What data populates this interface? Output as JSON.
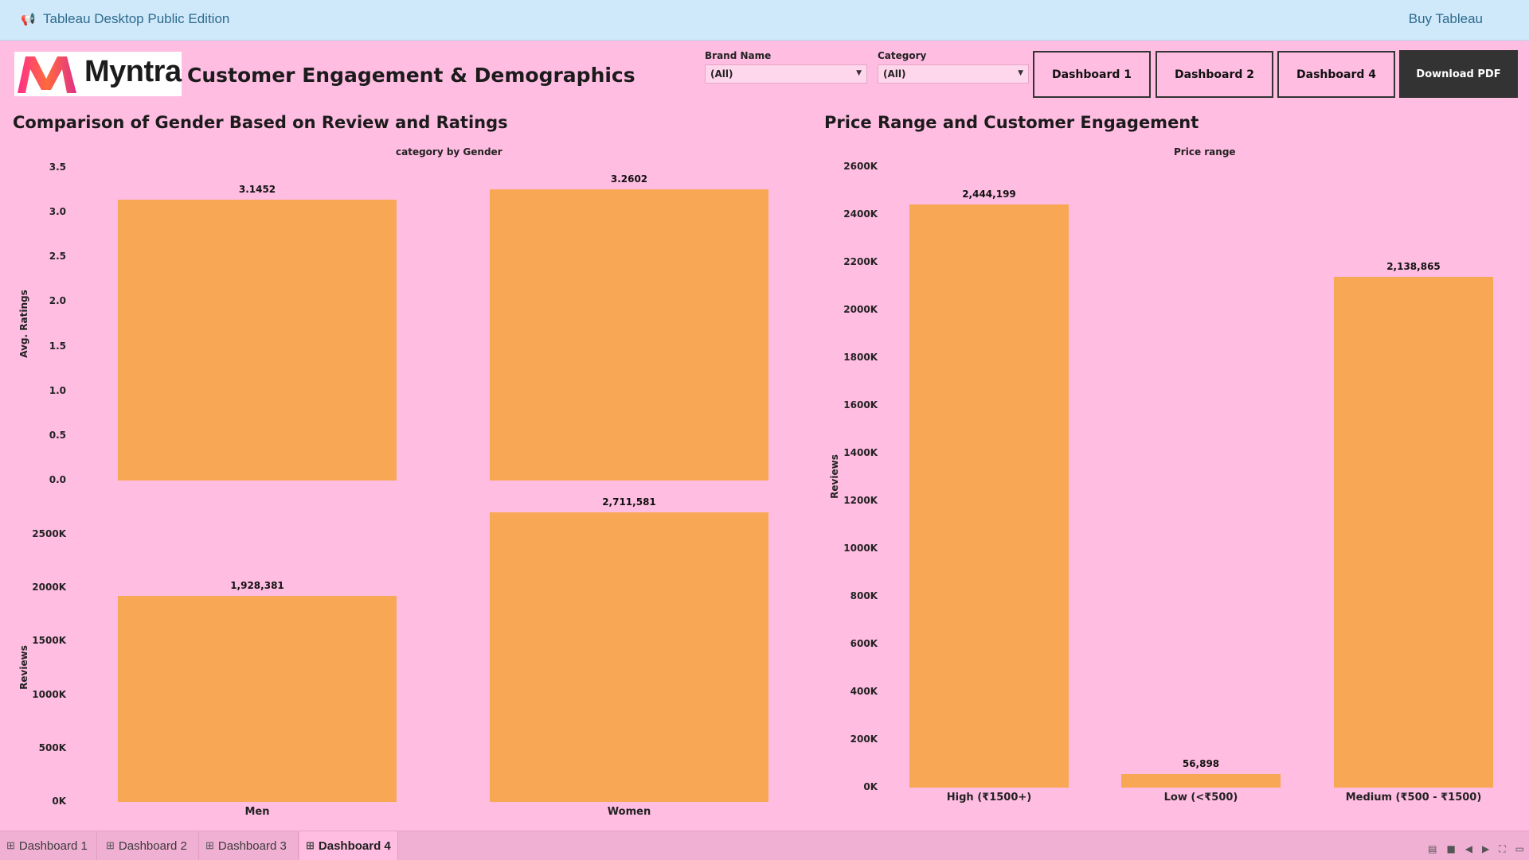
{
  "topbar": {
    "title": "Tableau Desktop Public Edition",
    "buy": "Buy Tableau",
    "icon": "megaphone-icon"
  },
  "header": {
    "logo_text": "Myntra",
    "title": "Customer Engagement & Demographics"
  },
  "filters": [
    {
      "label": "Brand Name",
      "value": "(All)"
    },
    {
      "label": "Category",
      "value": "(All)"
    }
  ],
  "nav_buttons": [
    "Dashboard 1",
    "Dashboard 2",
    "Dashboard 4"
  ],
  "download_label": "Download PDF",
  "left_chart": {
    "title": "Comparison of Gender Based on Review and Ratings",
    "subtitle": "category by Gender"
  },
  "right_chart": {
    "title": "Price Range and Customer Engagement",
    "subtitle": "Price range"
  },
  "chart_data": [
    {
      "type": "bar",
      "title": "",
      "categories": [
        "Men",
        "Women"
      ],
      "ylabel": "Avg. Ratings",
      "ylim": [
        0,
        3.5
      ],
      "yticks": [
        "0.0",
        "0.5",
        "1.0",
        "1.5",
        "2.0",
        "2.5",
        "3.0",
        "3.5"
      ],
      "values": [
        3.1452,
        3.2602
      ],
      "labels": [
        "3.1452",
        "3.2602"
      ]
    },
    {
      "type": "bar",
      "title": "",
      "categories": [
        "Men",
        "Women"
      ],
      "ylabel": "Reviews",
      "ylim": [
        0,
        2500000
      ],
      "yticks": [
        "0K",
        "500K",
        "1000K",
        "1500K",
        "2000K",
        "2500K"
      ],
      "values": [
        1928381,
        2711581
      ],
      "labels": [
        "1,928,381",
        "2,711,581"
      ]
    },
    {
      "type": "bar",
      "title": "",
      "categories": [
        "High (₹1500+)",
        "Low (<₹500)",
        "Medium (₹500 - ₹1500)"
      ],
      "ylabel": "Reviews",
      "ylim": [
        0,
        2600000
      ],
      "yticks": [
        "0K",
        "200K",
        "400K",
        "600K",
        "800K",
        "1000K",
        "1200K",
        "1400K",
        "1600K",
        "1800K",
        "2000K",
        "2200K",
        "2400K",
        "2600K"
      ],
      "values": [
        2444199,
        56898,
        2138865
      ],
      "labels": [
        "2,444,199",
        "56,898",
        "2,138,865"
      ]
    }
  ],
  "tabs": [
    {
      "label": "Dashboard 1",
      "active": false
    },
    {
      "label": "Dashboard 2",
      "active": false
    },
    {
      "label": "Dashboard 3",
      "active": false
    },
    {
      "label": "Dashboard 4",
      "active": true
    }
  ],
  "colors": {
    "bar": "#f8a755",
    "background": "#ffbde2",
    "topbar": "#cfe9fb"
  }
}
